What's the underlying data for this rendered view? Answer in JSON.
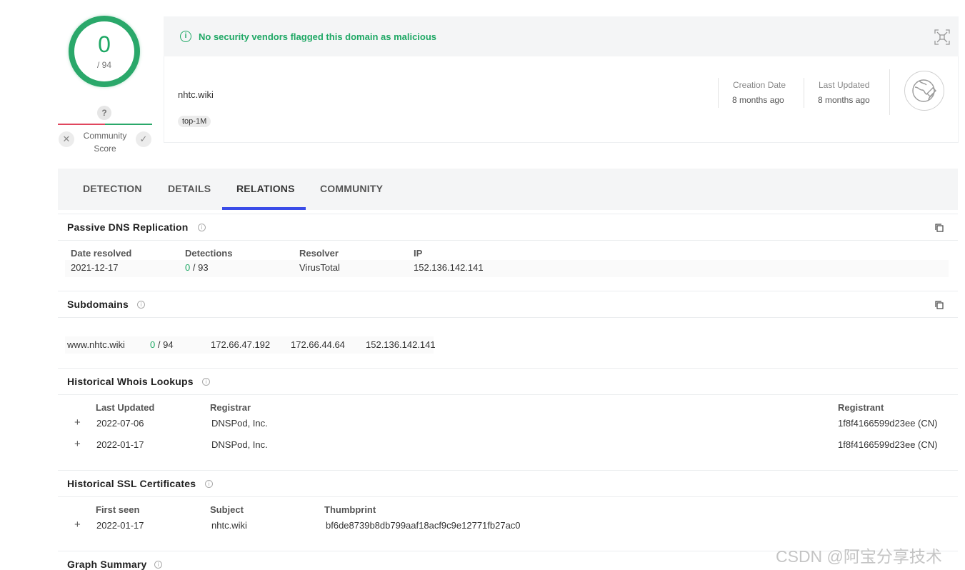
{
  "score": {
    "detections": "0",
    "total": "/ 94"
  },
  "community": {
    "unknown_glyph": "?",
    "label_line1": "Community",
    "label_line2": "Score",
    "x_glyph": "✕",
    "check_glyph": "✓"
  },
  "banner": {
    "icon_glyph": "i",
    "text": "No security vendors flagged this domain as malicious"
  },
  "domain": {
    "name": "nhtc.wiki",
    "tag": "top-1M"
  },
  "meta": {
    "creation_label": "Creation Date",
    "creation_value": "8 months ago",
    "updated_label": "Last Updated",
    "updated_value": "8 months ago"
  },
  "tabs": [
    {
      "label": "DETECTION"
    },
    {
      "label": "DETAILS"
    },
    {
      "label": "RELATIONS"
    },
    {
      "label": "COMMUNITY"
    }
  ],
  "passive_dns": {
    "title": "Passive DNS Replication",
    "headers": [
      "Date resolved",
      "Detections",
      "Resolver",
      "IP"
    ],
    "rows": [
      {
        "date": "2021-12-17",
        "det": "0",
        "det_total": "/ 93",
        "resolver": "VirusTotal",
        "ip": "152.136.142.141"
      }
    ]
  },
  "subdomains": {
    "title": "Subdomains",
    "rows": [
      {
        "name": "www.nhtc.wiki",
        "det": "0",
        "det_total": "/ 94",
        "ip1": "172.66.47.192",
        "ip2": "172.66.44.64",
        "ip3": "152.136.142.141"
      }
    ]
  },
  "whois": {
    "title": "Historical Whois Lookups",
    "headers": [
      "Last Updated",
      "Registrar",
      "Registrant"
    ],
    "rows": [
      {
        "date": "2022-07-06",
        "registrar": "DNSPod, Inc.",
        "registrant": "1f8f4166599d23ee (CN)"
      },
      {
        "date": "2022-01-17",
        "registrar": "DNSPod, Inc.",
        "registrant": "1f8f4166599d23ee (CN)"
      }
    ]
  },
  "ssl": {
    "title": "Historical SSL Certificates",
    "headers": [
      "First seen",
      "Subject",
      "Thumbprint"
    ],
    "rows": [
      {
        "date": "2022-01-17",
        "subject": "nhtc.wiki",
        "thumb": "bf6de8739b8db799aaf18acf9c9e12771fb27ac0"
      }
    ]
  },
  "graph": {
    "title": "Graph Summary"
  },
  "plus_glyph": "+",
  "info_glyph": "i",
  "watermark": "CSDN @阿宝分享技术",
  "colors": {
    "green": "#1fa865",
    "red": "#e0475e",
    "accent": "#3a4ce8"
  }
}
